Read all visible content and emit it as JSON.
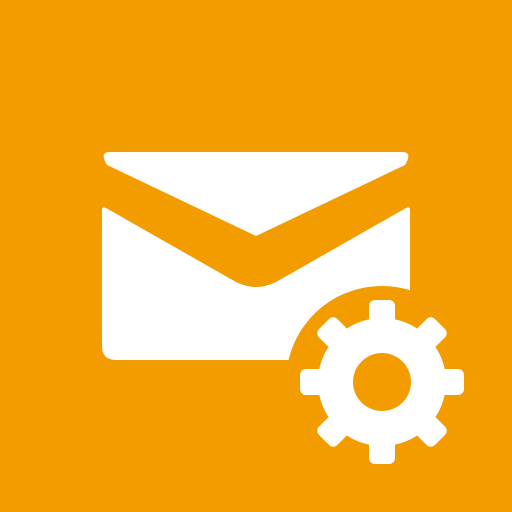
{
  "app_icon": {
    "name": "mail-settings",
    "background_color": "#F29C00",
    "foreground_color": "#FFFFFF",
    "icons": [
      "envelope-icon",
      "gear-icon"
    ]
  }
}
